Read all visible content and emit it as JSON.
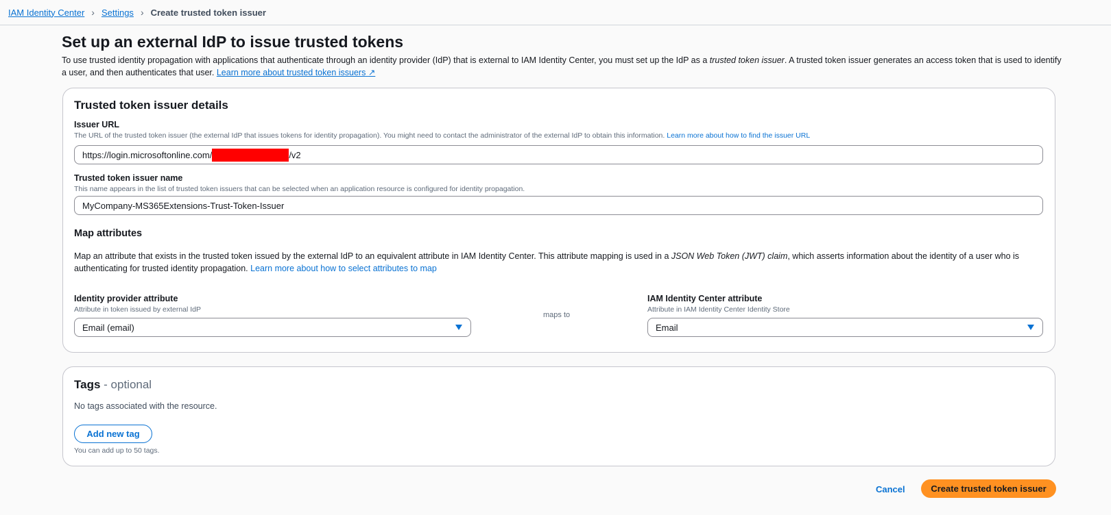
{
  "breadcrumb": {
    "items": [
      "IAM Identity Center",
      "Settings"
    ],
    "current": "Create trusted token issuer"
  },
  "page": {
    "title": "Set up an external IdP to issue trusted tokens",
    "intro_part1": "To use trusted identity propagation with applications that authenticate through an identity provider (IdP) that is external to IAM Identity Center, you must set up the IdP as a ",
    "intro_italic": "trusted token issuer",
    "intro_part2": ". A trusted token issuer generates an access token that is used to identify a user, and then authenticates that user. ",
    "intro_link": "Learn more about trusted token issuers"
  },
  "details": {
    "title": "Trusted token issuer details",
    "issuer_url": {
      "label": "Issuer URL",
      "desc": "The URL of the trusted token issuer (the external IdP that issues tokens for identity propagation). You might need to contact the administrator of the external IdP to obtain this information. ",
      "link": "Learn more about how to find the issuer URL",
      "value_prefix": "https://login.microsoftonline.com/",
      "value_suffix": "/v2"
    },
    "name": {
      "label": "Trusted token issuer name",
      "desc": "This name appears in the list of trusted token issuers that can be selected when an application resource is configured for identity propagation.",
      "value": "MyCompany-MS365Extensions-Trust-Token-Issuer"
    },
    "map": {
      "title": "Map attributes",
      "desc_part1": "Map an attribute that exists in the trusted token issued by the external IdP to an equivalent attribute in IAM Identity Center. This attribute mapping is used in a ",
      "desc_italic": "JSON Web Token (JWT) claim",
      "desc_part2": ", which asserts information about the identity of a user who is authenticating for trusted identity propagation. ",
      "link": "Learn more about how to select attributes to map",
      "idp_label": "Identity provider attribute",
      "idp_desc": "Attribute in token issued by external IdP",
      "idp_value": "Email (email)",
      "maps_to": "maps to",
      "iam_label": "IAM Identity Center attribute",
      "iam_desc": "Attribute in IAM Identity Center Identity Store",
      "iam_value": "Email"
    }
  },
  "tags": {
    "title": "Tags",
    "optional": " - optional",
    "empty": "No tags associated with the resource.",
    "add": "Add new tag",
    "limit": "You can add up to 50 tags."
  },
  "footer": {
    "cancel": "Cancel",
    "create": "Create trusted token issuer"
  }
}
